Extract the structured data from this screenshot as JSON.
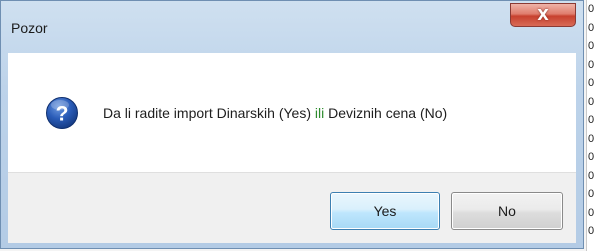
{
  "window": {
    "title": "Pozor",
    "close_label": "X"
  },
  "message": {
    "part1": "Da li radite import Dinarskih (Yes) ",
    "connector": "ili",
    "part2": " Deviznih cena (No)",
    "icon": "question-icon"
  },
  "buttons": {
    "yes_label": "Yes",
    "no_label": "No"
  },
  "background": {
    "digits": [
      "0",
      "0",
      "0",
      "0",
      "0",
      "0",
      "0",
      "0",
      "0",
      "0",
      "0",
      "0",
      "0"
    ]
  },
  "colors": {
    "title_bar": "#bdd3ea",
    "close_button": "#c7412f",
    "question_icon": "#1f4fa3",
    "ili_text": "#2e8b2e",
    "default_button_border": "#3c7fb1"
  }
}
